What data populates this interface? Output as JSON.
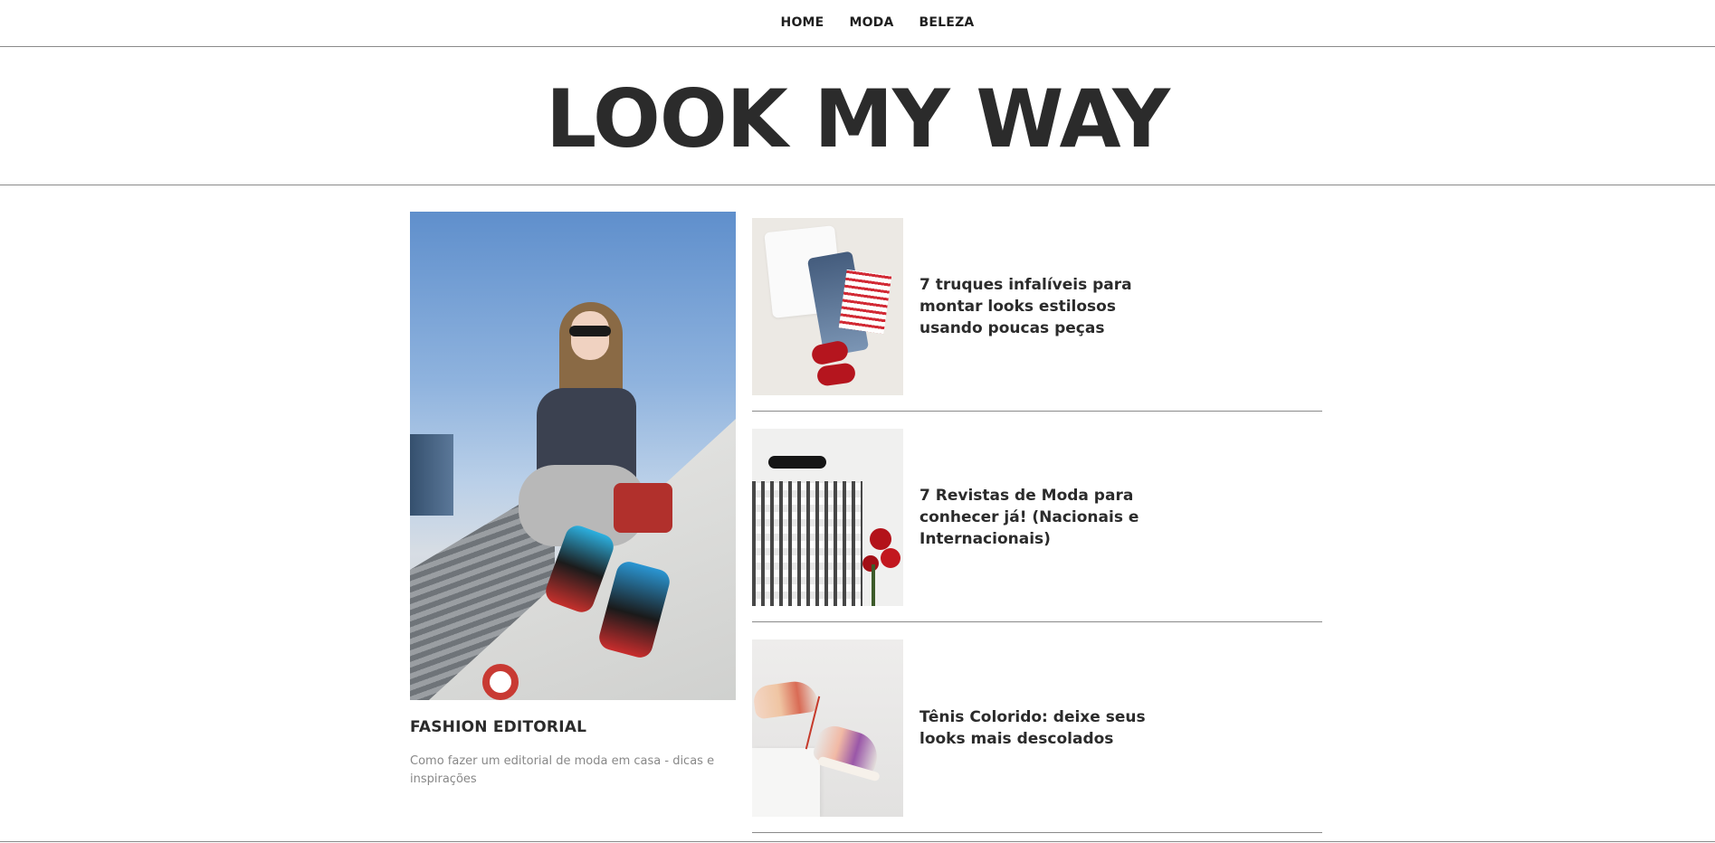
{
  "nav": {
    "items": [
      {
        "label": "HOME"
      },
      {
        "label": "MODA"
      },
      {
        "label": "BELEZA"
      }
    ]
  },
  "masthead": {
    "title": "LOOK MY WAY"
  },
  "featured": {
    "category": "FASHION EDITORIAL",
    "description": "Como fazer um editorial de moda em casa - dicas e inspirações",
    "image_alt": "Mulher sentada em muro com tênis coloridos"
  },
  "posts": [
    {
      "title": "7 truques infalíveis para montar looks estilosos usando poucas peças"
    },
    {
      "title": "7 Revistas de Moda para conhecer já! (Nacionais e Internacionais)"
    },
    {
      "title": "Tênis Colorido: deixe seus looks mais descolados"
    }
  ],
  "colors": {
    "text": "#2b2b2b",
    "muted": "#888888",
    "divider": "#8a8a8a",
    "background": "#ffffff"
  }
}
